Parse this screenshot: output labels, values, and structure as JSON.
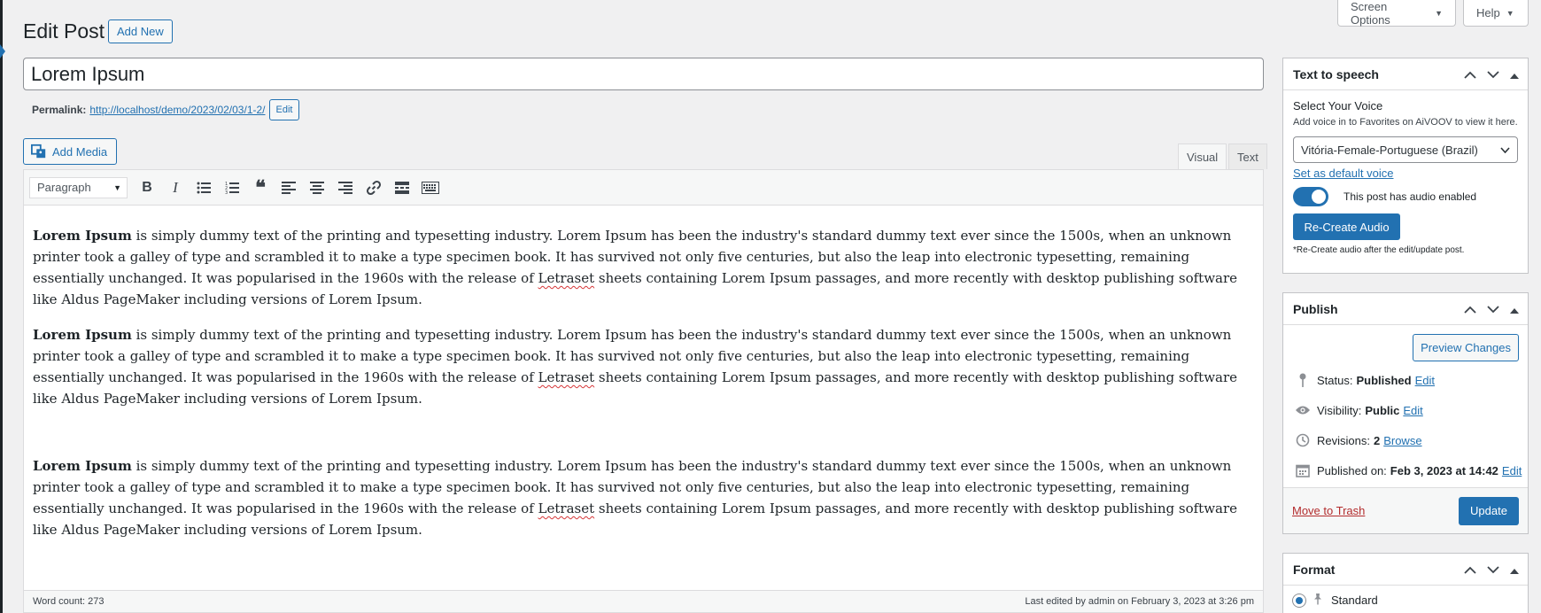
{
  "screen_options": "Screen Options",
  "help": "Help",
  "page_title": "Edit Post",
  "add_new": "Add New",
  "post_title": "Lorem Ipsum",
  "permalink": {
    "label": "Permalink:",
    "url": "http://localhost/demo/2023/02/03/1-2/",
    "edit": "Edit"
  },
  "add_media": "Add Media",
  "tabs": {
    "visual": "Visual",
    "text": "Text"
  },
  "toolbar": {
    "format": "Paragraph"
  },
  "content": {
    "bold": "Lorem Ipsum",
    "text_a": " is simply dummy text of the printing and typesetting industry. Lorem Ipsum has been the industry's standard dummy text ever since the 1500s, when an unknown printer took a galley of type and scrambled it to make a type specimen book. It has survived not only five centuries, but also the leap into electronic typesetting, remaining essentially unchanged. It was popularised in the 1960s with the release of ",
    "misspelled": "Letraset",
    "text_b": " sheets containing Lorem Ipsum passages, and more recently with desktop publishing software like Aldus PageMaker including versions of Lorem Ipsum."
  },
  "status_bar": {
    "word_count": "Word count: 273",
    "last_edited": "Last edited by admin on February 3, 2023 at 3:26 pm"
  },
  "tts": {
    "title": "Text to speech",
    "select_label": "Select Your Voice",
    "hint": "Add voice in to Favorites on AiVOOV to view it here.",
    "voice": "Vitória-Female-Portuguese (Brazil)",
    "set_default": "Set as default voice",
    "audio_enabled": "This post has audio enabled",
    "audio_enabled_on": true,
    "recreate": "Re-Create Audio",
    "note": "*Re-Create audio after the edit/update post."
  },
  "publish": {
    "title": "Publish",
    "preview": "Preview Changes",
    "status_label": "Status:",
    "status_value": "Published",
    "visibility_label": "Visibility:",
    "visibility_value": "Public",
    "revisions_label": "Revisions:",
    "revisions_value": "2",
    "browse": "Browse",
    "published_label": "Published on:",
    "published_value": "Feb 3, 2023 at 14:42",
    "edit": "Edit",
    "trash": "Move to Trash",
    "update": "Update"
  },
  "format": {
    "title": "Format",
    "standard": "Standard"
  },
  "colors": {
    "accent": "#2271b1",
    "bg": "#f0f0f1"
  }
}
